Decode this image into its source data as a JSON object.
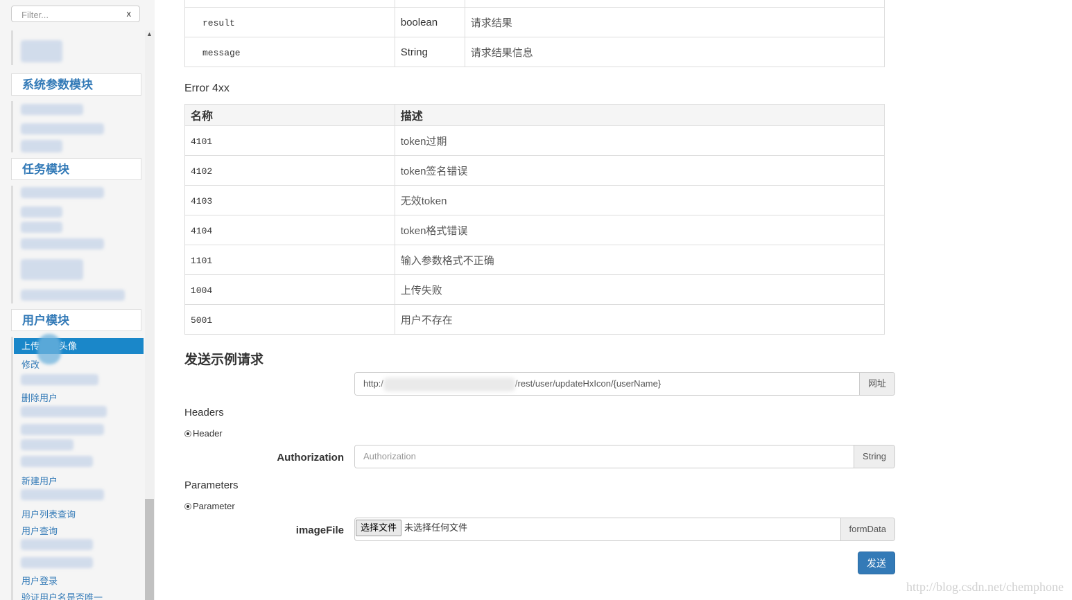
{
  "sidebar": {
    "filter_placeholder": "Filter...",
    "filter_clear": "x",
    "scroll_up": "▲",
    "sections": [
      "系统参数模块",
      "任务模块",
      "用户模块"
    ],
    "items": [
      {
        "label": "上传",
        "tail": "头像"
      },
      {
        "label": "修改"
      },
      {
        "label": "删除用户"
      },
      {
        "label": "新建用户"
      },
      {
        "label": "用户列表查询"
      },
      {
        "label": "用户查询"
      },
      {
        "label": "用户登录"
      },
      {
        "label": "验证用户名是否唯一"
      }
    ]
  },
  "response_table": {
    "rows": [
      {
        "name": "result",
        "type": "boolean",
        "desc": "请求结果"
      },
      {
        "name": "message",
        "type": "String",
        "desc": "请求结果信息"
      }
    ]
  },
  "error_section": {
    "title": "Error 4xx",
    "headers": [
      "名称",
      "描述"
    ],
    "rows": [
      {
        "code": "4101",
        "desc": "token过期"
      },
      {
        "code": "4102",
        "desc": "token签名错误"
      },
      {
        "code": "4103",
        "desc": "无效token"
      },
      {
        "code": "4104",
        "desc": "token格式错误"
      },
      {
        "code": "1101",
        "desc": "输入参数格式不正确"
      },
      {
        "code": "1004",
        "desc": "上传失败"
      },
      {
        "code": "5001",
        "desc": "用户不存在"
      }
    ]
  },
  "sample_request": {
    "title": "发送示例请求",
    "url_prefix": "http:/",
    "url_suffix": "/rest/user/updateHxIcon/{userName}",
    "url_addon": "网址",
    "headers_title": "Headers",
    "header_radio": "Header",
    "auth_label": "Authorization",
    "auth_placeholder": "Authorization",
    "auth_addon": "String",
    "params_title": "Parameters",
    "param_radio": "Parameter",
    "file_label": "imageFile",
    "file_button": "选择文件",
    "file_status": "未选择任何文件",
    "file_addon": "formData",
    "send_label": "发送"
  },
  "watermark": "http://blog.csdn.net/chemphone"
}
